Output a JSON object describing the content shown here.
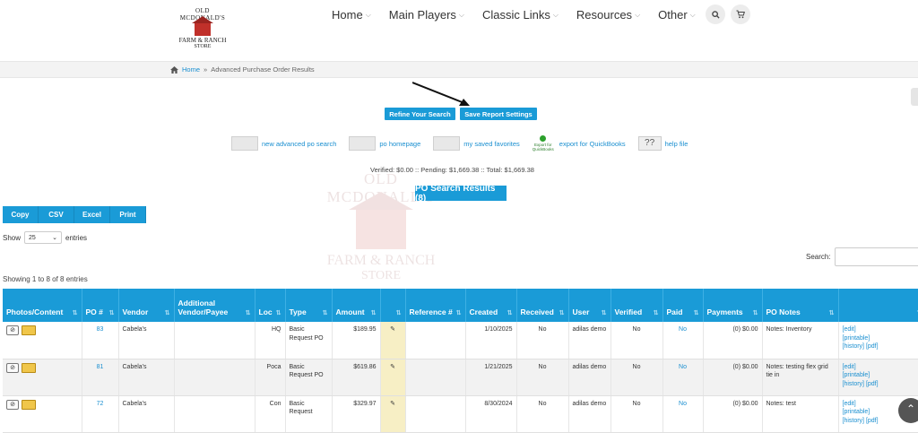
{
  "logo": {
    "line1": "OLD MCDONALD'S",
    "line2": "FARM & RANCH",
    "line3": "STORE"
  },
  "nav": [
    {
      "label": "Home"
    },
    {
      "label": "Main Players"
    },
    {
      "label": "Classic Links"
    },
    {
      "label": "Resources"
    },
    {
      "label": "Other"
    }
  ],
  "breadcrumb": {
    "home": "Home",
    "sep": "»",
    "current": "Advanced Purchase Order Results"
  },
  "buttons": {
    "refine": "Refine Your Search",
    "save": "Save Report Settings"
  },
  "links": {
    "new_search": "new advanced po search",
    "po_home": "po homepage",
    "favorites": "my saved favorites",
    "qb_icon_text": "Export for QuickBooks",
    "export_qb": "export for QuickBooks",
    "help": "help file"
  },
  "totals": "Verified: $0.00 :: Pending: $1,669.38 :: Total: $1,669.38",
  "results_badge": "PO Search Results (8)",
  "export": [
    "Copy",
    "CSV",
    "Excel",
    "Print"
  ],
  "show": {
    "label_before": "Show",
    "value": "25",
    "label_after": "entries"
  },
  "search_label": "Search:",
  "showing": "Showing 1 to 8 of 8 entries",
  "columns": [
    "Photos/Content",
    "PO #",
    "Vendor",
    "Additional Vendor/Payee",
    "Loc",
    "Type",
    "Amount",
    "",
    "Reference #",
    "Created",
    "Received",
    "User",
    "Verified",
    "Paid",
    "Payments",
    "PO Notes",
    ""
  ],
  "rows": [
    {
      "po": "83",
      "vendor": "Cabela's",
      "loc": "HQ",
      "type": "Basic Request PO",
      "amount": "$189.95",
      "created": "1/10/2025",
      "received": "No",
      "user": "adilas demo",
      "verified": "No",
      "paid": "No",
      "payments": "(0) $0.00",
      "notes": "Notes: Inventory"
    },
    {
      "po": "81",
      "vendor": "Cabela's",
      "loc": "Poca",
      "type": "Basic Request PO",
      "amount": "$619.86",
      "created": "1/21/2025",
      "received": "No",
      "user": "adilas demo",
      "verified": "No",
      "paid": "No",
      "payments": "(0) $0.00",
      "notes": "Notes: testing flex grid tie in"
    },
    {
      "po": "72",
      "vendor": "Cabela's",
      "loc": "Con",
      "type": "Basic Request",
      "amount": "$329.97",
      "created": "8/30/2024",
      "received": "No",
      "user": "adilas demo",
      "verified": "No",
      "paid": "No",
      "payments": "(0) $0.00",
      "notes": "Notes: test"
    }
  ],
  "actions": [
    "[edit]",
    "[printable]",
    "[history] [pdf]"
  ],
  "watermark": {
    "line1": "OLD MCDONALD'S",
    "line2": "FARM & RANCH",
    "line3": "STORE"
  }
}
